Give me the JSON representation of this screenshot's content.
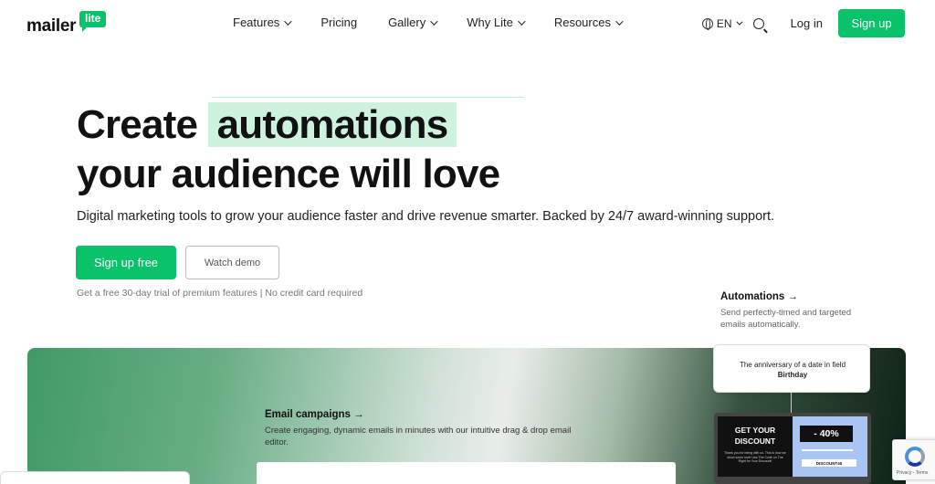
{
  "brand": {
    "logo_main": "mailer",
    "logo_tag": "lite",
    "accent": "#09c269",
    "highlight": "#cdf3df"
  },
  "nav": {
    "items": [
      {
        "label": "Features",
        "has_dropdown": true
      },
      {
        "label": "Pricing",
        "has_dropdown": false
      },
      {
        "label": "Gallery",
        "has_dropdown": true
      },
      {
        "label": "Why Lite",
        "has_dropdown": true
      },
      {
        "label": "Resources",
        "has_dropdown": true
      }
    ],
    "language": "EN",
    "login": "Log in",
    "signup": "Sign up"
  },
  "hero": {
    "title_prefix": "Create",
    "title_highlight": "automations",
    "title_line2": "your audience will love",
    "subtitle": "Digital marketing tools to grow your audience faster and drive revenue smarter. Backed by 24/7 award-winning support.",
    "primary_cta": "Sign up free",
    "secondary_cta": "Watch demo",
    "trial_note": "Get a free 30-day trial of premium features | No credit card required"
  },
  "features": {
    "automations": {
      "title": "Automations →",
      "description": "Send perfectly-timed and targeted emails automatically."
    },
    "email_campaigns": {
      "title": "Email campaigns →",
      "description": "Create engaging, dynamic emails in minutes with our intuitive drag & drop email editor."
    }
  },
  "automation_flow": {
    "trigger_text": "The anniversary of a date in field",
    "trigger_field": "Birthday",
    "promo_headline_1": "GET YOUR",
    "promo_headline_2": "DISCOUNT",
    "promo_small": "Thank you for being with us. This is how we show some love! Use The Code on The Right for Your Discount!",
    "promo_percent": "- 40%",
    "promo_code": "DISCOUNT40"
  },
  "recaptcha": {
    "text": "Privacy - Terms"
  }
}
